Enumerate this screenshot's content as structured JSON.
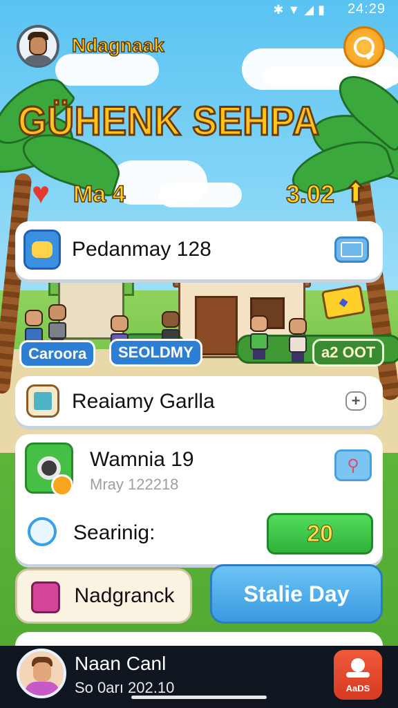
{
  "status_bar": {
    "time": "24:29",
    "icons": [
      "bluetooth-icon",
      "wifi-icon",
      "signal-icon",
      "battery-icon"
    ]
  },
  "header": {
    "player_name": "Ndagnaak",
    "title": "GÜHENK SEHPA",
    "lives_label": "Ma 4",
    "coins": "3.02"
  },
  "panels": {
    "top_card": {
      "label": "Pedanmay 128"
    },
    "village": {
      "tag_left": "Caroora",
      "tag_middle": "SEOLDMY",
      "tag_right": "a2 OOT"
    },
    "reward_card": {
      "label": "Reaiamy Garlla"
    },
    "task_card": {
      "title": "Wamnia 19",
      "subtitle": "Mray 122218",
      "search_label": "Searinig:",
      "search_value": "20"
    },
    "button_left": "Nadgranck",
    "button_right": "Stalie Day"
  },
  "bottom_bar": {
    "name": "Naan Canl",
    "date": "So 0arı 202.10",
    "action_label": "AaDS"
  },
  "colors": {
    "green_button": "#35c24a",
    "blue_button": "#4fb0ea",
    "title_yellow": "#ffc21f",
    "record_red": "#e24a2c"
  }
}
